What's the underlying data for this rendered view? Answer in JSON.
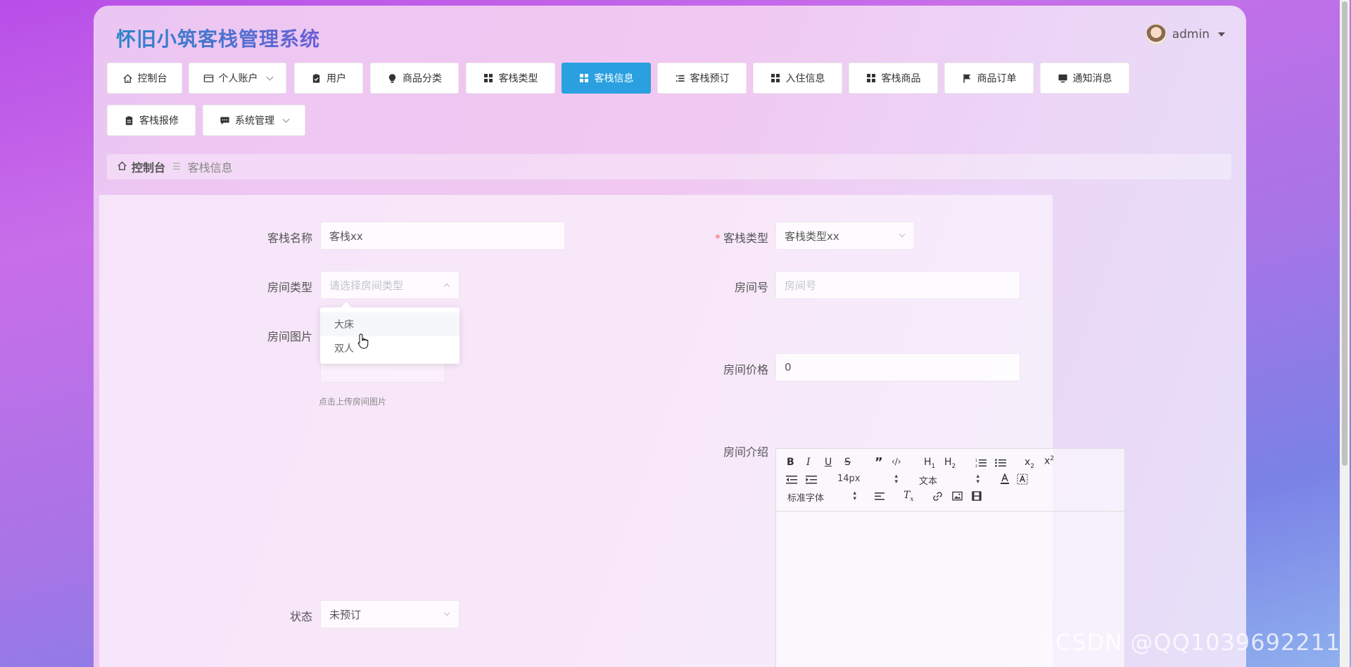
{
  "app": {
    "title": "怀旧小筑客栈管理系统"
  },
  "user": {
    "name": "admin"
  },
  "nav": {
    "items": [
      {
        "label": "控制台",
        "icon": "home-icon"
      },
      {
        "label": "个人账户",
        "icon": "wallet-icon"
      },
      {
        "label": "用户",
        "icon": "clipboard-check-icon"
      },
      {
        "label": "商品分类",
        "icon": "lightbulb-icon"
      },
      {
        "label": "客栈类型",
        "icon": "grid-icon"
      },
      {
        "label": "客栈信息",
        "icon": "grid-icon",
        "active": true
      },
      {
        "label": "客栈预订",
        "icon": "list-icon"
      },
      {
        "label": "入住信息",
        "icon": "grid-icon"
      },
      {
        "label": "客栈商品",
        "icon": "grid-icon"
      },
      {
        "label": "商品订单",
        "icon": "flag-icon"
      },
      {
        "label": "通知消息",
        "icon": "monitor-icon"
      },
      {
        "label": "客栈报修",
        "icon": "clipboard-icon"
      },
      {
        "label": "系统管理",
        "icon": "chat-icon"
      }
    ]
  },
  "breadcrumb": {
    "home": "控制台",
    "current": "客栈信息"
  },
  "form": {
    "inn_name": {
      "label": "客栈名称",
      "value": "客栈xx"
    },
    "inn_type": {
      "label": "客栈类型",
      "value": "客栈类型xx"
    },
    "room_type": {
      "label": "房间类型",
      "placeholder": "请选择房间类型",
      "options": [
        "大床",
        "双人"
      ]
    },
    "room_no": {
      "label": "房间号",
      "placeholder": "房间号"
    },
    "room_image": {
      "label": "房间图片",
      "hint": "点击上传房间图片"
    },
    "room_price": {
      "label": "房间价格",
      "value": "0"
    },
    "room_intro": {
      "label": "房间介绍"
    },
    "status": {
      "label": "状态",
      "value": "未预订"
    }
  },
  "editor": {
    "font_size": "14px",
    "header": "文本",
    "font_family": "标准字体"
  },
  "watermark": "CSDN @QQ1039692211",
  "colors": {
    "active_nav": "#2aa0e0",
    "required": "#f56c6c"
  }
}
